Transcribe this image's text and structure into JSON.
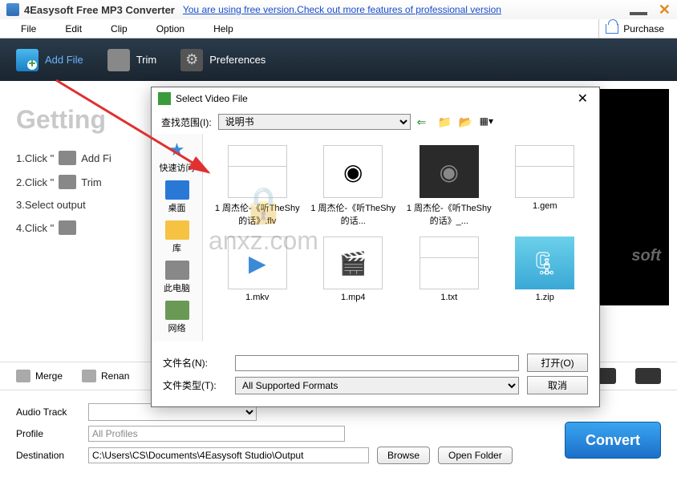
{
  "title": "4Easysoft Free MP3 Converter",
  "upgrade_link": "You are using free version.Check out more features of professional version",
  "menu": {
    "file": "File",
    "edit": "Edit",
    "clip": "Clip",
    "option": "Option",
    "help": "Help",
    "purchase": "Purchase"
  },
  "toolbar": {
    "add": "Add File",
    "trim": "Trim",
    "prefs": "Preferences"
  },
  "main": {
    "getting": "Getting",
    "steps": {
      "s1a": "1.Click \"",
      "s1b": "Add Fi",
      "s2a": "2.Click \"",
      "s2b": "Trim",
      "s3": "3.Select output",
      "s4a": "4.Click \""
    },
    "preview_watermark": "soft"
  },
  "buttons": {
    "merge": "Merge",
    "rename": "Renan"
  },
  "bottom": {
    "audio_track": "Audio Track",
    "profile": "Profile",
    "profile_value": "All Profiles",
    "destination": "Destination",
    "destination_value": "C:\\Users\\CS\\Documents\\4Easysoft Studio\\Output",
    "browse": "Browse",
    "open_folder": "Open Folder",
    "convert": "Convert"
  },
  "dialog": {
    "title": "Select Video File",
    "lookin_label": "查找范围(I):",
    "lookin_value": "说明书",
    "sidebar": {
      "quick": "快速访问",
      "desktop": "桌面",
      "library": "库",
      "thispc": "此电脑",
      "network": "网络"
    },
    "files": [
      {
        "name": "1 周杰伦-《听TheShy的话》.flv",
        "type": "doc"
      },
      {
        "name": "1 周杰伦-《听TheShy的话...",
        "type": "disc"
      },
      {
        "name": "1 周杰伦-《听TheShy的话》_...",
        "type": "darkdisc"
      },
      {
        "name": "1.gem",
        "type": "doc"
      },
      {
        "name": "1.mkv",
        "type": "video"
      },
      {
        "name": "1.mp4",
        "type": "thumb"
      },
      {
        "name": "1.txt",
        "type": "doc"
      },
      {
        "name": "1.zip",
        "type": "zip"
      }
    ],
    "filename_label": "文件名(N):",
    "filename_value": "",
    "filetype_label": "文件类型(T):",
    "filetype_value": "All Supported Formats",
    "open": "打开(O)",
    "cancel": "取消"
  },
  "watermark": {
    "text": "anxz.com"
  }
}
